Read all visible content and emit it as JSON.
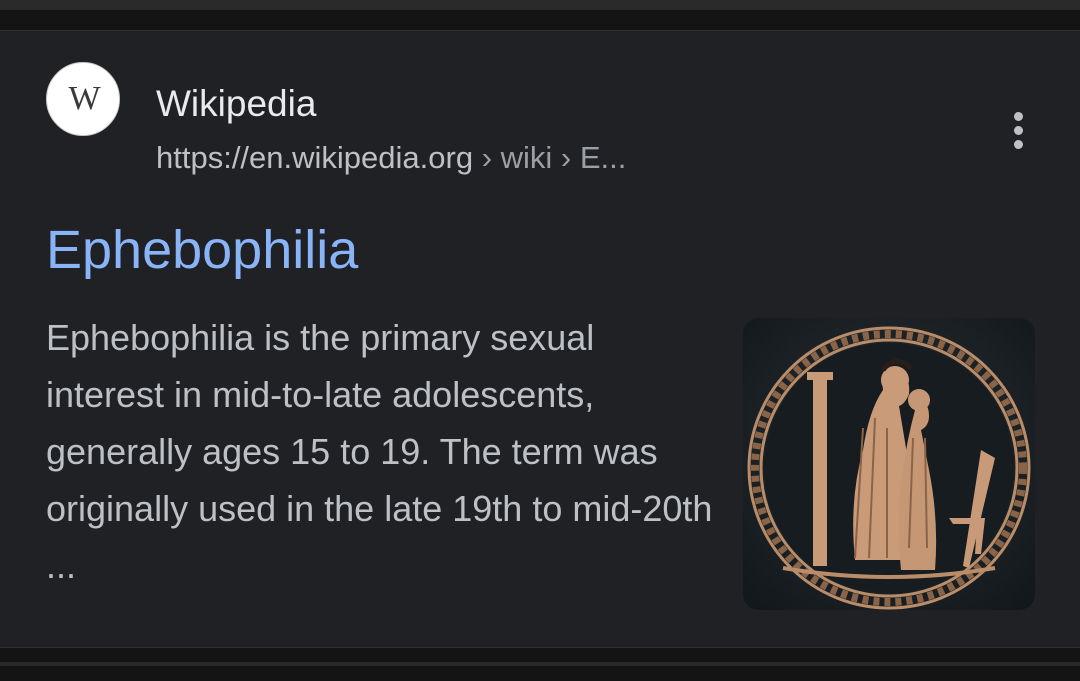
{
  "result": {
    "site_name": "Wikipedia",
    "favicon_letter": "W",
    "url_base": "https://en.wikipedia.org",
    "url_crumbs": " › wiki › E...",
    "title": "Ephebophilia",
    "snippet": "Ephebophilia is the primary sexual interest in mid-to-late adolescents, generally ages 15 to 19. The term was originally used in the late 19th to mid-20th ...",
    "more_icon": "more-vert-icon",
    "thumbnail_icon": "greek-pottery-thumbnail"
  },
  "colors": {
    "background": "#202124",
    "title_link": "#8ab4f8",
    "text_primary": "#e8eaed",
    "text_secondary": "#bdc1c6"
  }
}
